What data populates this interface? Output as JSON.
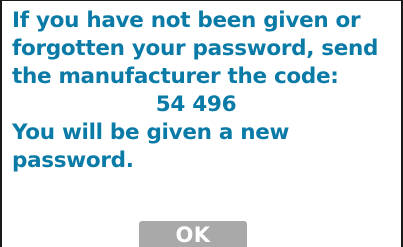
{
  "dialog": {
    "lines": [
      "If you have not been given or",
      "forgotten your password, send",
      "the manufacturer the code:",
      "54 496",
      "You will be given a new",
      "password."
    ],
    "ok_label": "OK",
    "colors": {
      "text": "#0a7aa6",
      "button_bg": "#a9a9a9",
      "button_text": "#ffffff",
      "background": "#ffffff"
    }
  }
}
